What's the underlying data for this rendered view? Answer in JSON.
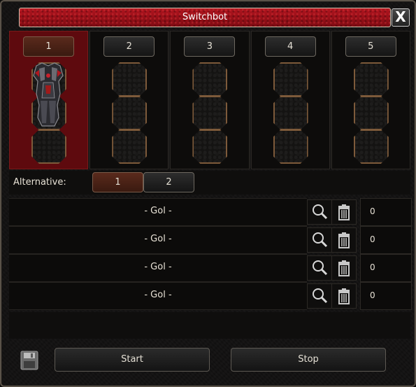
{
  "window": {
    "title": "Switchbot",
    "close_label": "X"
  },
  "slots": [
    {
      "label": "1",
      "active": true,
      "has_item": true
    },
    {
      "label": "2",
      "active": false,
      "has_item": false
    },
    {
      "label": "3",
      "active": false,
      "has_item": false
    },
    {
      "label": "4",
      "active": false,
      "has_item": false
    },
    {
      "label": "5",
      "active": false,
      "has_item": false
    }
  ],
  "alternative": {
    "label": "Alternative:",
    "options": [
      "1",
      "2"
    ],
    "selected": "1"
  },
  "goals": [
    {
      "text": "- Gol -",
      "value": "0"
    },
    {
      "text": "- Gol -",
      "value": "0"
    },
    {
      "text": "- Gol -",
      "value": "0"
    },
    {
      "text": "- Gol -",
      "value": "0"
    }
  ],
  "footer": {
    "start_label": "Start",
    "stop_label": "Stop"
  },
  "icons": {
    "search": "search-icon",
    "delete": "trash-icon",
    "save": "floppy-disk-icon",
    "close": "close-icon"
  },
  "colors": {
    "title_bar": "#9a0f17",
    "active_slot": "#5e0a0e",
    "cell_border": "#7d5a3a"
  }
}
